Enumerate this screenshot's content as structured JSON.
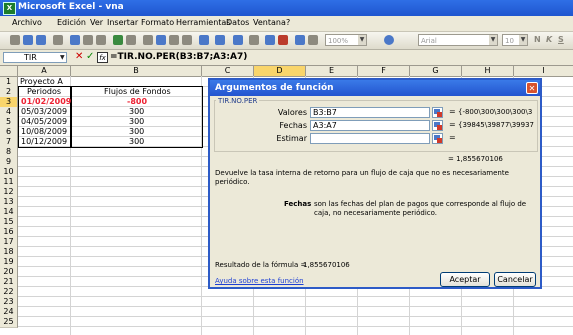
{
  "window": {
    "app_icon": "X",
    "title": "Microsoft Excel - vna"
  },
  "menu": [
    "Archivo",
    "Edición",
    "Ver",
    "Insertar",
    "Formato",
    "Herramientas",
    "Datos",
    "Ventana",
    "?"
  ],
  "toolbar": {
    "zoom": "100%",
    "font": "Arial",
    "font_size": "10",
    "bold": "N",
    "italic": "K",
    "underline": "S"
  },
  "formula_bar": {
    "name_box": "TIR",
    "cancel_icon": "✕",
    "enter_icon": "✓",
    "fx_icon": "fx",
    "formula": "=TIR.NO.PER(B3:B7;A3:A7)"
  },
  "sheet": {
    "columns": [
      "A",
      "B",
      "C",
      "D",
      "E",
      "F",
      "G",
      "H",
      "I"
    ],
    "rows": [
      "1",
      "2",
      "3",
      "4",
      "5",
      "6",
      "7",
      "8",
      "9",
      "10",
      "11",
      "12",
      "13",
      "14",
      "15",
      "16",
      "17",
      "18",
      "19",
      "20",
      "21",
      "22",
      "23",
      "24",
      "25"
    ],
    "cells": {
      "A1": "Proyecto A",
      "A2": "Periodos",
      "B2": "Flujos de Fondos",
      "A3": "01/02/2009",
      "B3": "-800",
      "A4": "05/03/2009",
      "B4": "300",
      "A5": "04/05/2009",
      "B5": "300",
      "A6": "10/08/2009",
      "B6": "300",
      "A7": "10/12/2009",
      "B7": "300"
    }
  },
  "dialog": {
    "title": "Argumentos de función",
    "close_icon": "✕",
    "function_name": "TIR.NO.PER",
    "args": [
      {
        "label": "Valores",
        "value": "B3:B7",
        "result": "{-800\\300\\300\\300\\3"
      },
      {
        "label": "Fechas",
        "value": "A3:A7",
        "result": "{39845\\39877\\39937"
      },
      {
        "label": "Estimar",
        "value": "",
        "result": ""
      }
    ],
    "equals": "=",
    "function_result": "= 1,855670106",
    "description": "Devuelve la tasa interna de retorno para un flujo de caja que no es necesariamente periódico.",
    "arg_help_name": "Fechas",
    "arg_help_text": "son las fechas del plan de pagos que corresponde al flujo de caja, no necesariamente periódico.",
    "formula_result_label": "Resultado de la fórmula =",
    "formula_result_value": "1,855670106",
    "help_link": "Ayuda sobre esta función",
    "ok_label": "Aceptar",
    "cancel_label": "Cancelar"
  }
}
